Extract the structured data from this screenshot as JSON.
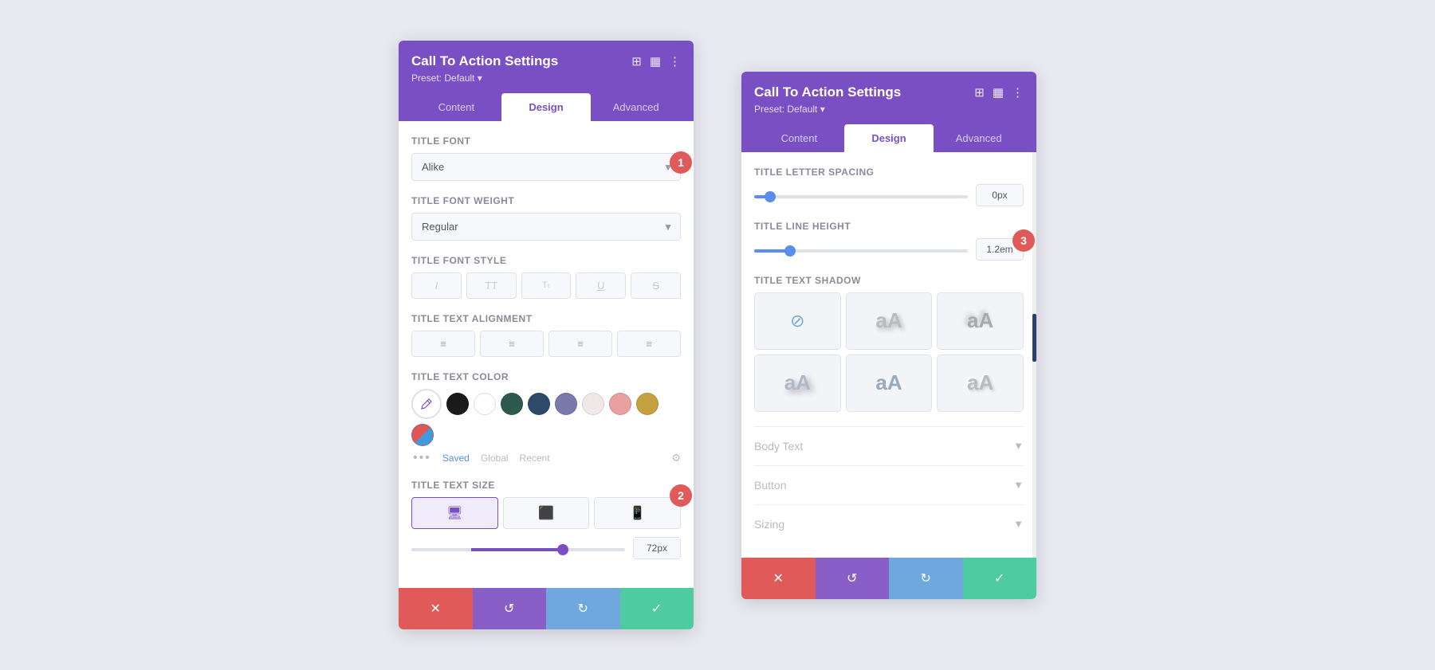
{
  "panel1": {
    "title": "Call To Action Settings",
    "preset": "Preset: Default ▾",
    "tabs": [
      "Content",
      "Design",
      "Advanced"
    ],
    "active_tab": "Design",
    "title_font_label": "Title Font",
    "title_font_value": "Alike",
    "title_font_weight_label": "Title Font Weight",
    "title_font_weight_value": "Regular",
    "title_font_style_label": "Title Font Style",
    "font_style_options": [
      "I",
      "TT",
      "Tₜ",
      "U",
      "S"
    ],
    "title_text_align_label": "Title Text Alignment",
    "align_options": [
      "≡",
      "≡",
      "≡",
      "≡"
    ],
    "title_text_color_label": "Title Text Color",
    "colors": [
      "#1a1a1a",
      "#ffffff",
      "#2e5a4e",
      "#2d4a6a",
      "#7a7aaa",
      "#f0e8e8",
      "#e8a0a0",
      "#c4a040",
      "#e05555"
    ],
    "color_tabs": [
      "Saved",
      "Global",
      "Recent"
    ],
    "title_text_size_label": "Title Text Size",
    "title_text_size_value": "72px",
    "title_text_size_slider": 72,
    "badge1": "1",
    "badge2": "2",
    "footer": {
      "cancel": "✕",
      "undo": "↺",
      "redo": "↻",
      "confirm": "✓"
    }
  },
  "panel2": {
    "title": "Call To Action Settings",
    "preset": "Preset: Default ▾",
    "tabs": [
      "Content",
      "Design",
      "Advanced"
    ],
    "active_tab": "Design",
    "title_letter_spacing_label": "Title Letter Spacing",
    "title_letter_spacing_value": "0px",
    "title_line_height_label": "Title Line Height",
    "title_line_height_value": "1.2em",
    "title_text_shadow_label": "Title Text Shadow",
    "body_text_label": "Body Text",
    "button_label": "Button",
    "sizing_label": "Sizing",
    "badge3": "3",
    "footer": {
      "cancel": "✕",
      "undo": "↺",
      "redo": "↻",
      "confirm": "✓"
    }
  }
}
